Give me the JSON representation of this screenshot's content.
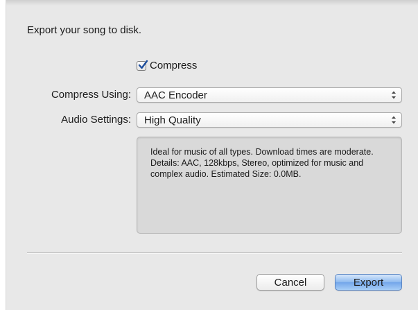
{
  "dialog": {
    "prompt": "Export your song to disk.",
    "compress": {
      "label": "Compress",
      "checked": true
    },
    "compress_using": {
      "label": "Compress Using:",
      "value": "AAC Encoder"
    },
    "audio_settings": {
      "label": "Audio Settings:",
      "value": "High Quality"
    },
    "description": "Ideal for music of all types. Download times are moderate. Details: AAC, 128kbps, Stereo, optimized for music and complex audio. Estimated Size: 0.0MB.",
    "buttons": {
      "cancel": "Cancel",
      "export": "Export"
    }
  },
  "icons": {
    "checkmark": "check-icon",
    "popup_arrows": "up-down-arrows-icon"
  },
  "colors": {
    "default_button": "#73a6ea",
    "checkmark": "#1f4f9e"
  }
}
